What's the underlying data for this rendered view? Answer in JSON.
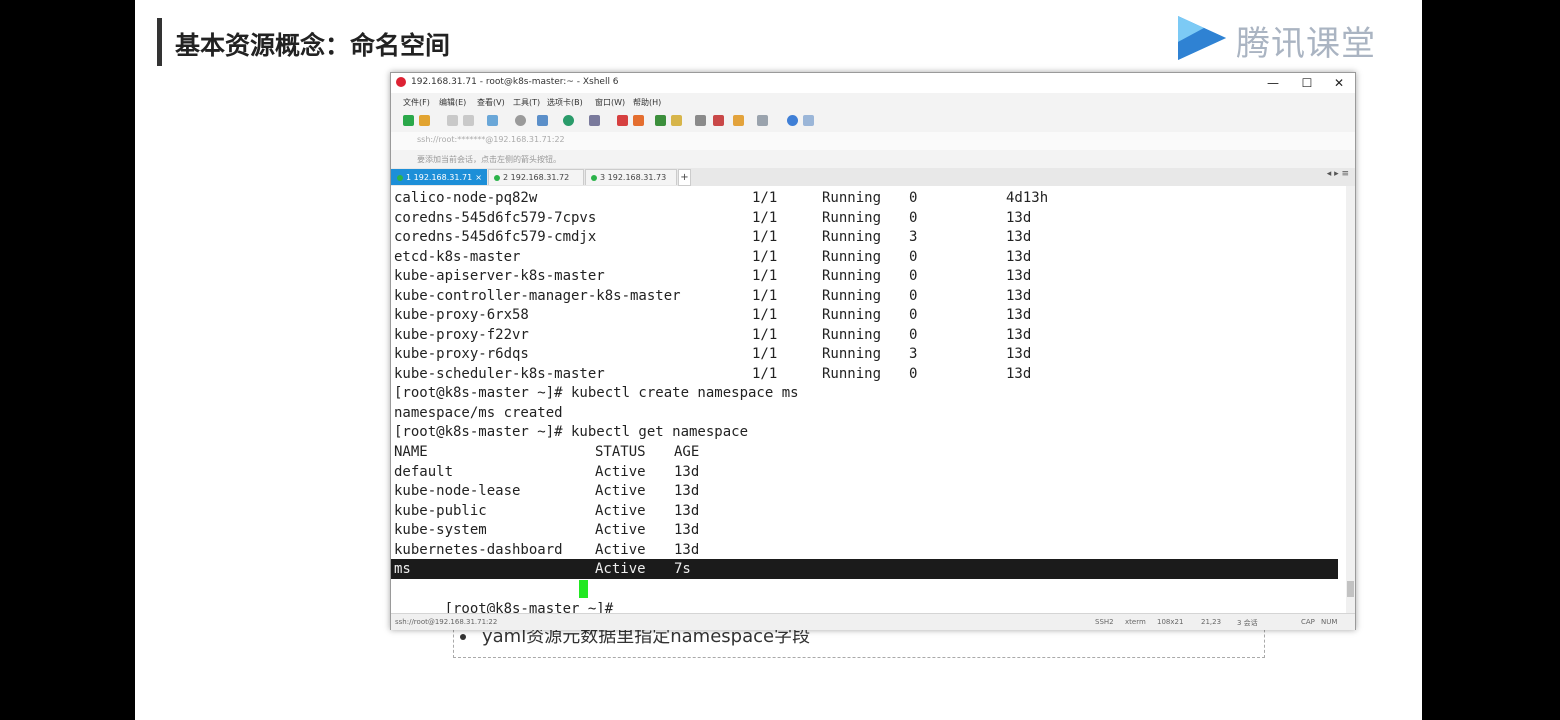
{
  "slide": {
    "title": "基本资源概念：命名空间",
    "logo_text": "腾讯课堂",
    "bullet_text": "yaml资源元数据里指定namespace字段"
  },
  "window": {
    "title": "192.168.31.71 - root@k8s-master:~ - Xshell 6",
    "controls": {
      "minimize": "—",
      "maximize": "☐",
      "close": "✕"
    },
    "menu": [
      "文件(F)",
      "编辑(E)",
      "查看(V)",
      "工具(T)",
      "选项卡(B)",
      "窗口(W)",
      "帮助(H)"
    ],
    "address": "ssh://root:*******@192.168.31.71:22",
    "hint": "要添加当前会话，点击左侧的箭头按钮。",
    "tabs": [
      {
        "label": "1 192.168.31.71",
        "active": true
      },
      {
        "label": "2 192.168.31.72",
        "active": false
      },
      {
        "label": "3 192.168.31.73",
        "active": false
      }
    ],
    "tab_add": "+",
    "tab_arrows": "◂ ▸ ≡"
  },
  "terminal": {
    "pods": [
      {
        "name": "calico-node-pq82w",
        "ready": "1/1",
        "status": "Running",
        "restarts": "0",
        "age": "4d13h"
      },
      {
        "name": "coredns-545d6fc579-7cpvs",
        "ready": "1/1",
        "status": "Running",
        "restarts": "0",
        "age": "13d"
      },
      {
        "name": "coredns-545d6fc579-cmdjx",
        "ready": "1/1",
        "status": "Running",
        "restarts": "3",
        "age": "13d"
      },
      {
        "name": "etcd-k8s-master",
        "ready": "1/1",
        "status": "Running",
        "restarts": "0",
        "age": "13d"
      },
      {
        "name": "kube-apiserver-k8s-master",
        "ready": "1/1",
        "status": "Running",
        "restarts": "0",
        "age": "13d"
      },
      {
        "name": "kube-controller-manager-k8s-master",
        "ready": "1/1",
        "status": "Running",
        "restarts": "0",
        "age": "13d"
      },
      {
        "name": "kube-proxy-6rx58",
        "ready": "1/1",
        "status": "Running",
        "restarts": "0",
        "age": "13d"
      },
      {
        "name": "kube-proxy-f22vr",
        "ready": "1/1",
        "status": "Running",
        "restarts": "0",
        "age": "13d"
      },
      {
        "name": "kube-proxy-r6dqs",
        "ready": "1/1",
        "status": "Running",
        "restarts": "3",
        "age": "13d"
      },
      {
        "name": "kube-scheduler-k8s-master",
        "ready": "1/1",
        "status": "Running",
        "restarts": "0",
        "age": "13d"
      }
    ],
    "cmd1": "[root@k8s-master ~]# kubectl create namespace ms",
    "out1": "namespace/ms created",
    "cmd2": "[root@k8s-master ~]# kubectl get namespace",
    "ns_header": {
      "name": "NAME",
      "status": "STATUS",
      "age": "AGE"
    },
    "namespaces": [
      {
        "name": "default",
        "status": "Active",
        "age": "13d"
      },
      {
        "name": "kube-node-lease",
        "status": "Active",
        "age": "13d"
      },
      {
        "name": "kube-public",
        "status": "Active",
        "age": "13d"
      },
      {
        "name": "kube-system",
        "status": "Active",
        "age": "13d"
      },
      {
        "name": "kubernetes-dashboard",
        "status": "Active",
        "age": "13d"
      }
    ],
    "selected_ns": {
      "name": "ms",
      "status": "Active",
      "age": "7s"
    },
    "prompt": "[root@k8s-master ~]# "
  },
  "statusbar": {
    "connection": "ssh://root@192.168.31.71:22",
    "protocol": "SSH2",
    "term": "xterm",
    "size": "108x21",
    "pos": "21,23",
    "sessions": "3 会话",
    "cap": "CAP",
    "num": "NUM"
  },
  "colors": {
    "cursor": "#22e822",
    "active_tab": "#1d8fd8",
    "selection_bg": "#1b1b1b"
  }
}
